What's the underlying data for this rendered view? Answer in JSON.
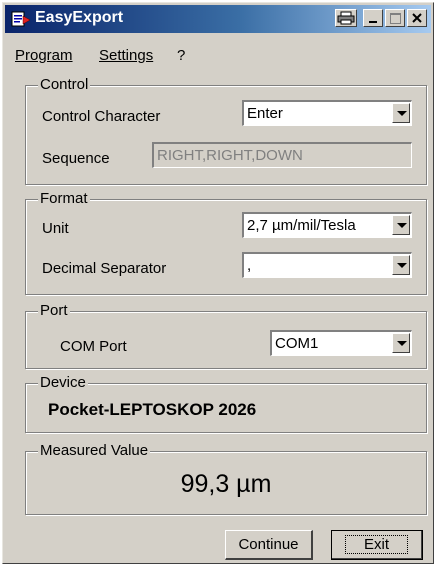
{
  "window": {
    "title": "EasyExport"
  },
  "menu": {
    "program": "Program",
    "settings": "Settings",
    "help": "?"
  },
  "control": {
    "title": "Control",
    "control_character_label": "Control Character",
    "control_character_value": "Enter",
    "sequence_label": "Sequence",
    "sequence_value": "RIGHT,RIGHT,DOWN"
  },
  "format": {
    "title": "Format",
    "unit_label": "Unit",
    "unit_value": "2,7 µm/mil/Tesla",
    "decimal_label": "Decimal Separator",
    "decimal_value": ","
  },
  "port": {
    "title": "Port",
    "com_label": "COM Port",
    "com_value": "COM1"
  },
  "device": {
    "title": "Device",
    "name": "Pocket-LEPTOSKOP 2026"
  },
  "measured": {
    "title": "Measured Value",
    "value": "99,3 µm"
  },
  "buttons": {
    "continue": "Continue",
    "exit": "Exit"
  },
  "colors": {
    "titlebar_start": "#0a246a",
    "titlebar_end": "#a6caf0",
    "face": "#d4d0c8"
  }
}
